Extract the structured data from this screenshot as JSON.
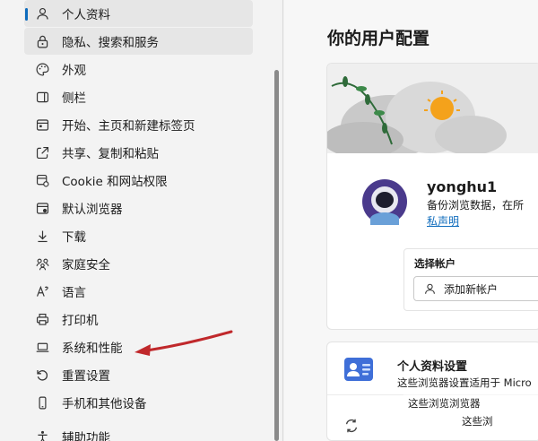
{
  "sidebar": {
    "items": [
      {
        "label": "个人资料",
        "icon": "user-icon",
        "selected": true
      },
      {
        "label": "隐私、搜索和服务",
        "icon": "lock-icon",
        "selected": false
      },
      {
        "label": "外观",
        "icon": "palette-icon",
        "selected": false
      },
      {
        "label": "侧栏",
        "icon": "sidebar-icon",
        "selected": false
      },
      {
        "label": "开始、主页和新建标签页",
        "icon": "home-tabs-icon",
        "selected": false
      },
      {
        "label": "共享、复制和粘贴",
        "icon": "share-icon",
        "selected": false
      },
      {
        "label": "Cookie 和网站权限",
        "icon": "site-permissions-icon",
        "selected": false
      },
      {
        "label": "默认浏览器",
        "icon": "browser-icon",
        "selected": false
      },
      {
        "label": "下载",
        "icon": "download-icon",
        "selected": false
      },
      {
        "label": "家庭安全",
        "icon": "family-icon",
        "selected": false
      },
      {
        "label": "语言",
        "icon": "language-icon",
        "selected": false
      },
      {
        "label": "打印机",
        "icon": "printer-icon",
        "selected": false
      },
      {
        "label": "系统和性能",
        "icon": "laptop-icon",
        "selected": false
      },
      {
        "label": "重置设置",
        "icon": "reset-icon",
        "selected": false
      },
      {
        "label": "手机和其他设备",
        "icon": "phone-icon",
        "selected": false
      },
      {
        "label": "辅助功能",
        "icon": "accessibility-icon",
        "selected": false
      }
    ]
  },
  "main": {
    "title": "你的用户配置",
    "profile": {
      "username": "yonghu1",
      "description": "备份浏览数据，在所",
      "privacy_link": "私声明"
    },
    "account": {
      "label": "选择帐户",
      "add_button": "添加新帐户"
    },
    "profile_settings": {
      "title": "个人资料设置",
      "description": "这些浏览器设置适用于 Micro",
      "ghost_line1": "这些浏览浏览器",
      "ghost_line2": "这些浏"
    }
  },
  "colors": {
    "accent": "#0f6cbd",
    "arrow": "#c0282b",
    "sidebar_bg": "#f3f3f3",
    "selected_bg": "#e6e6e6"
  }
}
